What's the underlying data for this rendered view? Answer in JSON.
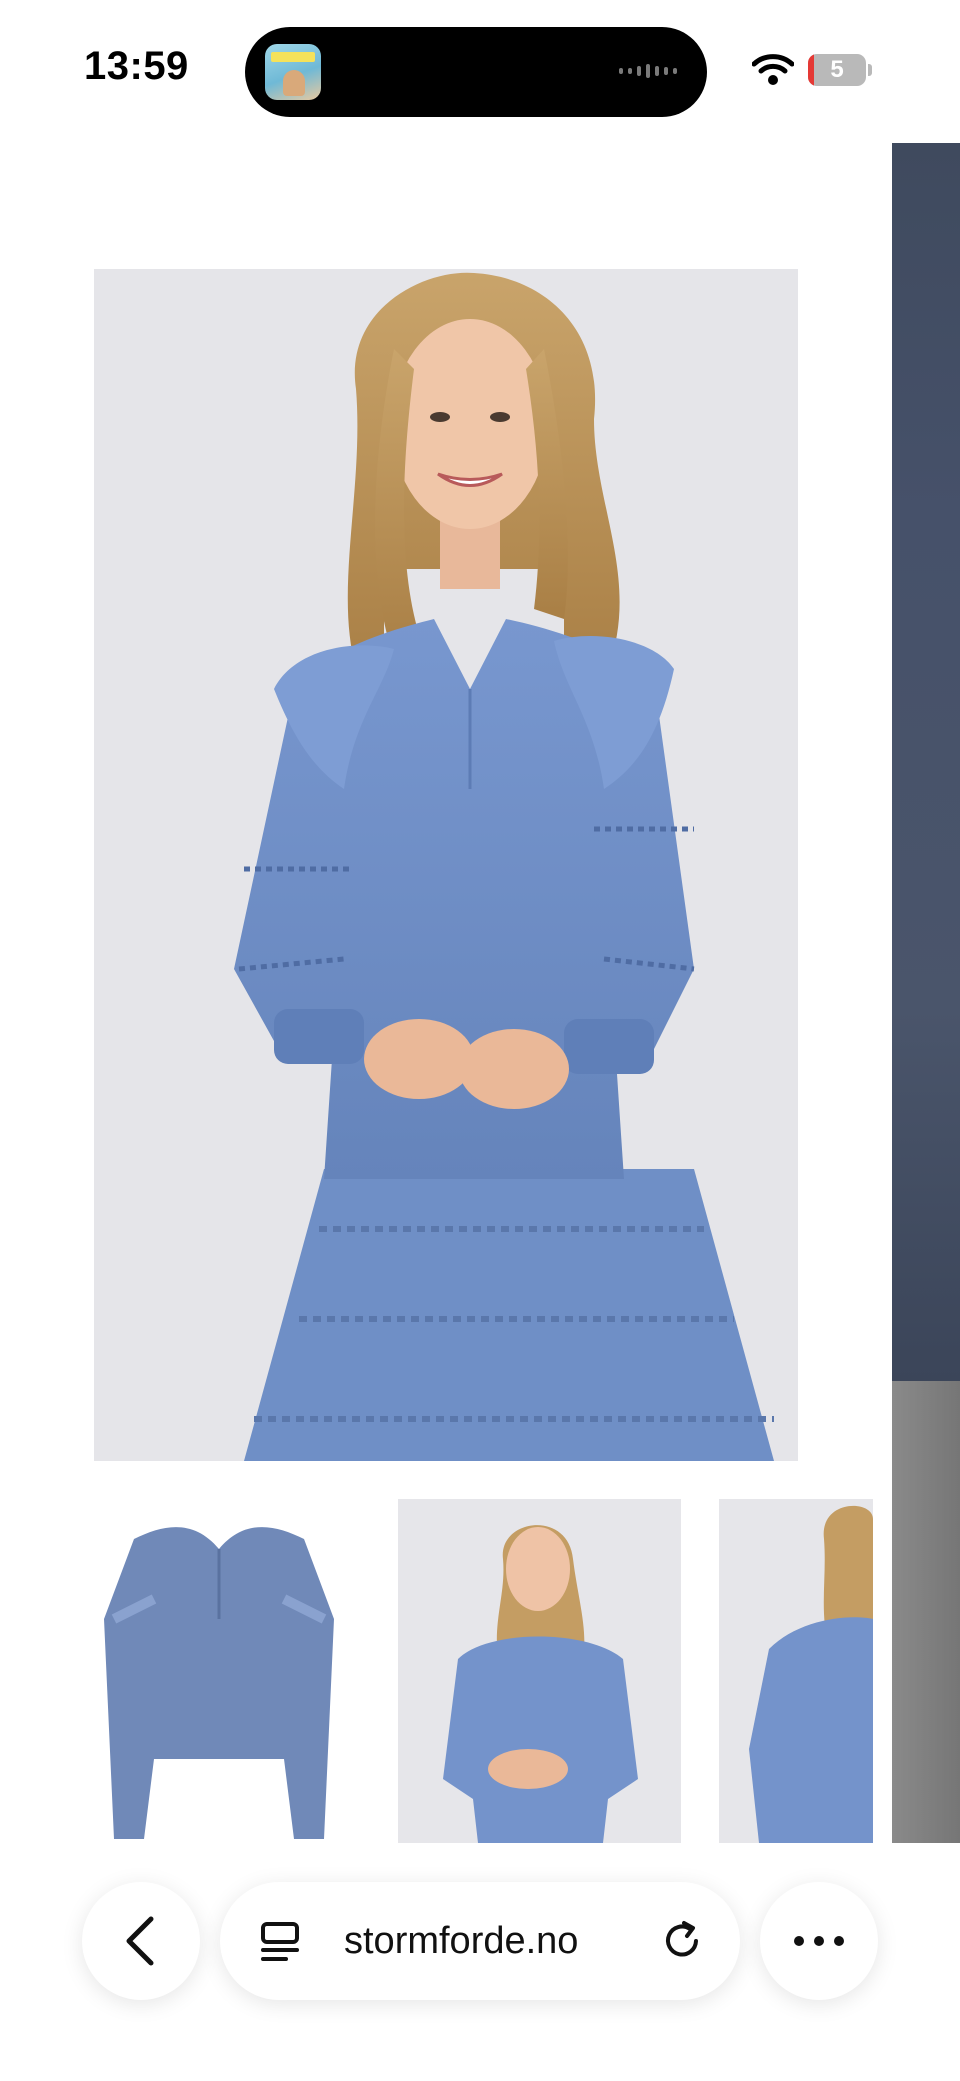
{
  "status_bar": {
    "time": "13:59",
    "battery_level": "5",
    "battery_color": "#e53935",
    "icons": [
      "wifi-icon",
      "battery-icon"
    ],
    "dynamic_island": {
      "media_thumbnail": "podcast-artwork",
      "activity": "audio-waveform-icon"
    }
  },
  "product_gallery": {
    "main_image": {
      "alt": "Woman wearing blue ruffled blouse and matching tiered skirt"
    },
    "thumbnails": [
      {
        "alt": "Blue ruffled blouse product shot"
      },
      {
        "alt": "Model wearing blue blouse and skirt, front view"
      },
      {
        "alt": "Model wearing blue blouse, back view"
      }
    ],
    "next_slide_peek": "dark-grey-garment-image"
  },
  "browser_toolbar": {
    "url": "stormforde.no",
    "icons": [
      "chevron-left-icon",
      "tabs-icon",
      "reload-icon",
      "more-dots-icon"
    ]
  },
  "colors": {
    "garment_blue": "#6f8fc6",
    "photo_background": "#e5e5e9"
  }
}
